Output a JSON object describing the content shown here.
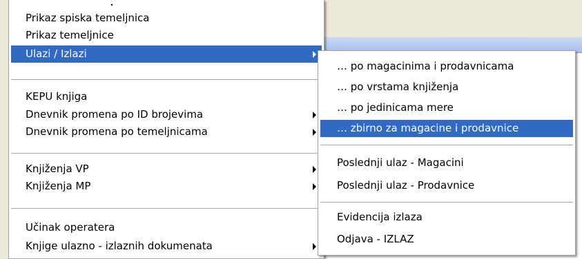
{
  "main_menu": {
    "items": [
      {
        "label": "Prikaz spiska temeljnica",
        "submenu": false,
        "selected": false
      },
      {
        "label": "Prikaz temeljnice",
        "submenu": false,
        "selected": false
      },
      {
        "label": "Ulazi / Izlazi",
        "submenu": true,
        "selected": true
      },
      {
        "label": "KEPU knjiga",
        "submenu": false,
        "selected": false
      },
      {
        "label": "Dnevnik promena po ID brojevima",
        "submenu": true,
        "selected": false
      },
      {
        "label": "Dnevnik promena po temeljnicama",
        "submenu": true,
        "selected": false
      },
      {
        "label": "Knjiženja VP",
        "submenu": true,
        "selected": false
      },
      {
        "label": "Knjiženja MP",
        "submenu": true,
        "selected": false
      },
      {
        "label": "Učinak operatera",
        "submenu": false,
        "selected": false
      },
      {
        "label": "Knjige ulazno - izlaznih dokumenata",
        "submenu": true,
        "selected": false
      }
    ]
  },
  "sub_menu": {
    "items": [
      {
        "label": "… po magacinima i prodavnicama",
        "selected": false
      },
      {
        "label": "… po vrstama knjiženja",
        "selected": false
      },
      {
        "label": "… po jedinicama mere",
        "selected": false
      },
      {
        "label": "… zbirno za magacine i prodavnice",
        "selected": true
      },
      {
        "label": "Poslednji ulaz - Magacini",
        "selected": false
      },
      {
        "label": "Poslednji ulaz - Prodavnice",
        "selected": false
      },
      {
        "label": "Evidencija izlaza",
        "selected": false
      },
      {
        "label": "Odjava - IZLAZ",
        "selected": false
      }
    ]
  },
  "colors": {
    "highlight": "#316ac5",
    "menu_background": "#ffffff",
    "separator": "#a7a7a7"
  }
}
